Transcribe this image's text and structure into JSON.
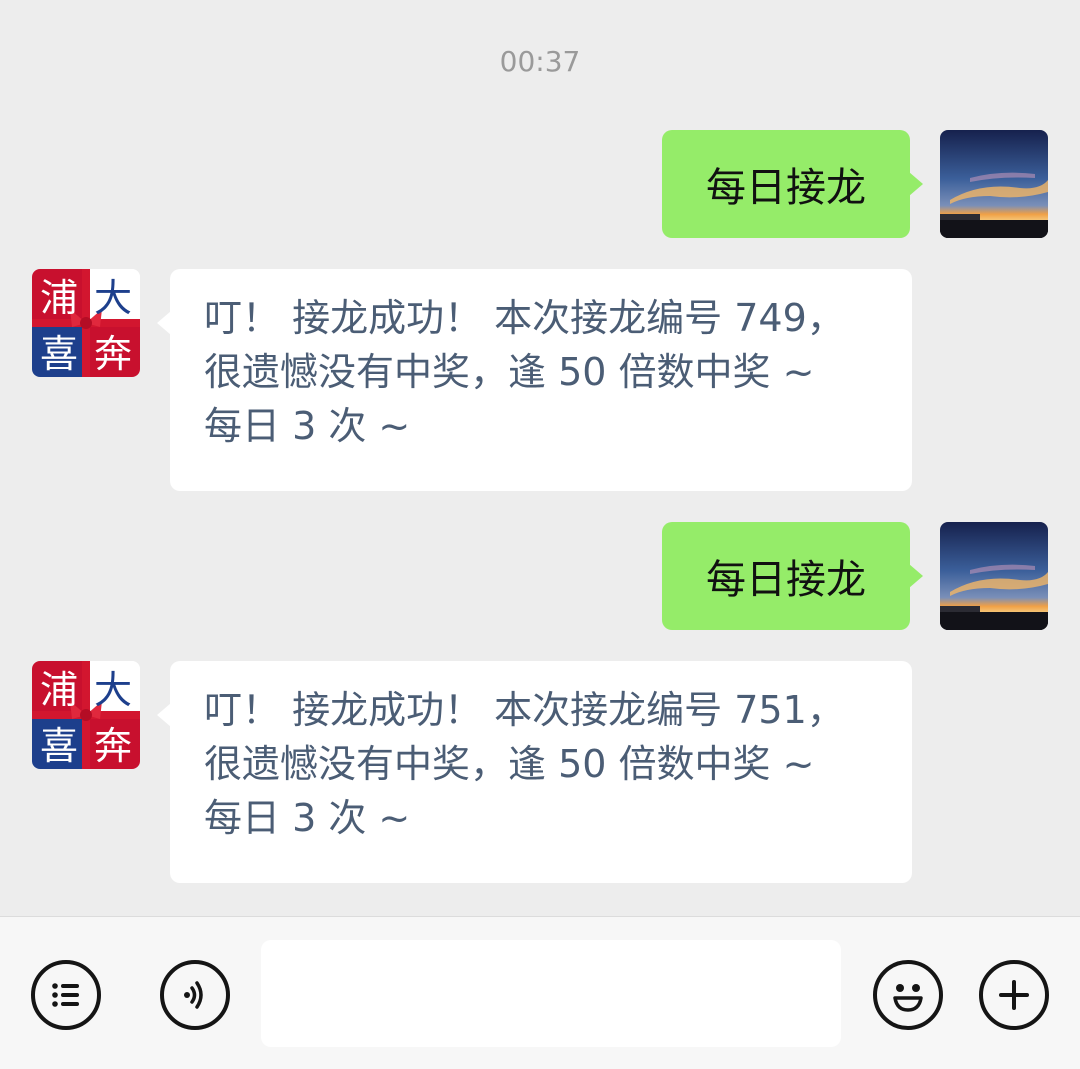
{
  "chat": {
    "timestamp": "00:37",
    "messages": [
      {
        "from": "self",
        "text": "每日接龙"
      },
      {
        "from": "bot",
        "lines": [
          "叮！ 接龙成功！ 本次接龙编号 749，",
          "很遗憾没有中奖，逢 50 倍数中奖 ~",
          "每日 3 次 ~"
        ]
      },
      {
        "from": "self",
        "text": "每日接龙"
      },
      {
        "from": "bot",
        "lines": [
          "叮！ 接龙成功！ 本次接龙编号 751，",
          "很遗憾没有中奖，逢 50 倍数中奖 ~",
          "每日 3 次 ~"
        ]
      }
    ]
  },
  "bot_avatar": {
    "chars": [
      "浦",
      "大",
      "喜",
      "奔"
    ],
    "colors": {
      "red": "#c8102e",
      "blue": "#1d3f8c",
      "ribbon": "#d2162f"
    }
  },
  "self_avatar": {
    "description_icon": "sunset-photo-icon",
    "colors": {
      "sky_top": "#1c2a5a",
      "sky_mid": "#3b5f9a",
      "glow": "#f0a046",
      "water": "#1a1a22"
    }
  },
  "bubble_colors": {
    "outgoing": "#95ec69",
    "incoming": "#ffffff",
    "incoming_text": "#4b5d75"
  },
  "input_bar": {
    "left_icons": [
      "menu-list-icon",
      "voice-icon"
    ],
    "right_icons": [
      "emoji-icon",
      "plus-icon"
    ],
    "input_value": ""
  }
}
